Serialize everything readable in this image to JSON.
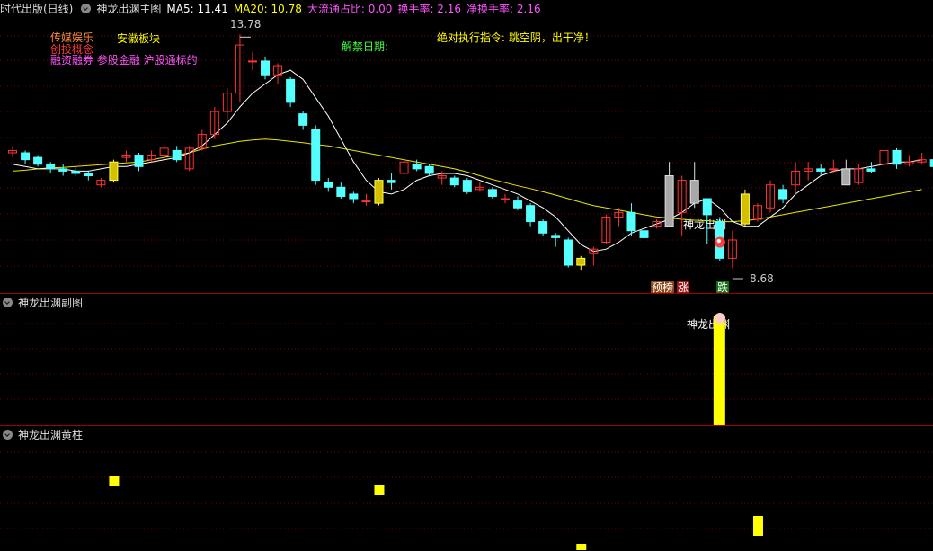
{
  "main_header": {
    "stock": "时代出版(日线)",
    "indicator": "神龙出渊主图",
    "ma5_label": "MA5: 11.41",
    "ma20_label": "MA20: 10.78",
    "flow_label": "大流通占比: 0.00",
    "turnover_label": "换手率: 2.16",
    "net_turnover_label": "净换手率: 2.16"
  },
  "annotations": {
    "sector1": "传媒娱乐",
    "sector2": "创投概念",
    "sector3": "融资融券 参股金融 沪股通标的",
    "region": "安徽板块",
    "unlock": "解禁日期:",
    "instruction": "绝对执行指令: 跳空阴，出干净！",
    "high_price": "13.78",
    "low_price": "8.68",
    "signal_text": "神龙出渊",
    "tag_predict": "预榜",
    "tag_up": "涨",
    "tag_down": "跌"
  },
  "sub1_header": {
    "title": "神龙出渊副图",
    "signal_text": "神龙出渊"
  },
  "sub2_header": {
    "title": "神龙出渊黄柱"
  },
  "colors": {
    "up": "#ff3232",
    "down": "#54ffff",
    "ma5": "#ffffff",
    "ma20": "#e6e600",
    "yellow": "#ffff00",
    "grid": "#7a0000",
    "separator": "#a00000",
    "ma5_text": "#ffffff",
    "ma20_text": "#ffff00",
    "flow_text": "#ff54ff"
  },
  "chart_data": {
    "type": "candlestick",
    "y_range": [
      8.3,
      14.1
    ],
    "high_marker": 13.78,
    "low_marker": 8.68,
    "candles": [
      {
        "o": 11.2,
        "c": 11.25,
        "h": 11.35,
        "l": 11.1
      },
      {
        "o": 11.2,
        "c": 11.05,
        "h": 11.25,
        "l": 10.95
      },
      {
        "o": 11.1,
        "c": 10.95,
        "h": 11.15,
        "l": 10.9
      },
      {
        "o": 10.95,
        "c": 10.85,
        "h": 11.0,
        "l": 10.75
      },
      {
        "o": 10.85,
        "c": 10.8,
        "h": 10.95,
        "l": 10.7
      },
      {
        "o": 10.8,
        "c": 10.75,
        "h": 10.9,
        "l": 10.7
      },
      {
        "o": 10.75,
        "c": 10.7,
        "h": 10.8,
        "l": 10.6
      },
      {
        "o": 10.5,
        "c": 10.6,
        "h": 10.65,
        "l": 10.45
      },
      {
        "o": 10.6,
        "c": 11.0,
        "h": 11.05,
        "l": 10.55,
        "gold": true
      },
      {
        "o": 11.1,
        "c": 11.15,
        "h": 11.25,
        "l": 11.0
      },
      {
        "o": 11.15,
        "c": 10.9,
        "h": 11.2,
        "l": 10.8
      },
      {
        "o": 11.05,
        "c": 11.15,
        "h": 11.25,
        "l": 11.0
      },
      {
        "o": 11.15,
        "c": 11.3,
        "h": 11.35,
        "l": 11.1
      },
      {
        "o": 11.25,
        "c": 11.05,
        "h": 11.35,
        "l": 11.0
      },
      {
        "o": 10.85,
        "c": 11.3,
        "h": 11.35,
        "l": 10.8
      },
      {
        "o": 11.3,
        "c": 11.6,
        "h": 11.7,
        "l": 11.25
      },
      {
        "o": 11.6,
        "c": 12.1,
        "h": 12.2,
        "l": 11.5
      },
      {
        "o": 12.1,
        "c": 12.5,
        "h": 12.6,
        "l": 11.9
      },
      {
        "o": 12.5,
        "c": 13.55,
        "h": 13.78,
        "l": 12.3
      },
      {
        "o": 13.2,
        "c": 13.2,
        "h": 13.4,
        "l": 13.0
      },
      {
        "o": 13.2,
        "c": 12.9,
        "h": 13.3,
        "l": 12.8
      },
      {
        "o": 12.9,
        "c": 13.1,
        "h": 13.15,
        "l": 12.7
      },
      {
        "o": 12.8,
        "c": 12.3,
        "h": 12.85,
        "l": 12.2
      },
      {
        "o": 12.05,
        "c": 11.8,
        "h": 12.1,
        "l": 11.7
      },
      {
        "o": 11.7,
        "c": 10.6,
        "h": 11.8,
        "l": 10.5
      },
      {
        "o": 10.55,
        "c": 10.45,
        "h": 10.65,
        "l": 10.35
      },
      {
        "o": 10.45,
        "c": 10.25,
        "h": 10.55,
        "l": 10.2
      },
      {
        "o": 10.3,
        "c": 10.2,
        "h": 10.35,
        "l": 10.1
      },
      {
        "o": 10.15,
        "c": 10.15,
        "h": 10.3,
        "l": 10.05
      },
      {
        "o": 10.1,
        "c": 10.6,
        "h": 10.65,
        "l": 10.05,
        "gold": true
      },
      {
        "o": 10.6,
        "c": 10.55,
        "h": 10.75,
        "l": 10.4
      },
      {
        "o": 10.75,
        "c": 11.0,
        "h": 11.1,
        "l": 10.6
      },
      {
        "o": 10.95,
        "c": 10.85,
        "h": 11.05,
        "l": 10.8
      },
      {
        "o": 10.9,
        "c": 10.75,
        "h": 10.95,
        "l": 10.7
      },
      {
        "o": 10.65,
        "c": 10.7,
        "h": 10.8,
        "l": 10.5
      },
      {
        "o": 10.65,
        "c": 10.5,
        "h": 10.7,
        "l": 10.45
      },
      {
        "o": 10.6,
        "c": 10.35,
        "h": 10.65,
        "l": 10.3
      },
      {
        "o": 10.4,
        "c": 10.45,
        "h": 10.55,
        "l": 10.35
      },
      {
        "o": 10.4,
        "c": 10.25,
        "h": 10.45,
        "l": 10.2
      },
      {
        "o": 10.2,
        "c": 10.2,
        "h": 10.3,
        "l": 10.1
      },
      {
        "o": 10.15,
        "c": 10.0,
        "h": 10.25,
        "l": 9.95
      },
      {
        "o": 10.05,
        "c": 9.7,
        "h": 10.1,
        "l": 9.6
      },
      {
        "o": 9.7,
        "c": 9.45,
        "h": 9.75,
        "l": 9.4
      },
      {
        "o": 9.4,
        "c": 9.35,
        "h": 9.45,
        "l": 9.15
      },
      {
        "o": 9.3,
        "c": 8.75,
        "h": 9.35,
        "l": 8.7
      },
      {
        "o": 8.75,
        "c": 8.9,
        "h": 8.95,
        "l": 8.65,
        "gold": true
      },
      {
        "o": 9.0,
        "c": 9.1,
        "h": 9.15,
        "l": 8.75
      },
      {
        "o": 9.25,
        "c": 9.8,
        "h": 9.85,
        "l": 9.2
      },
      {
        "o": 9.8,
        "c": 9.9,
        "h": 10.0,
        "l": 9.6
      },
      {
        "o": 9.9,
        "c": 9.5,
        "h": 10.1,
        "l": 9.4
      },
      {
        "o": 9.5,
        "c": 9.35,
        "h": 9.55,
        "l": 9.3
      },
      {
        "o": 9.6,
        "c": 9.7,
        "h": 9.75,
        "l": 9.55
      },
      {
        "o": 9.6,
        "c": 10.7,
        "h": 11.0,
        "l": 9.6,
        "gray": true
      },
      {
        "o": 9.9,
        "c": 10.6,
        "h": 10.7,
        "l": 9.4
      },
      {
        "o": 10.1,
        "c": 10.6,
        "h": 11.0,
        "l": 10.0,
        "gray": true
      },
      {
        "o": 10.2,
        "c": 9.85,
        "h": 10.2,
        "l": 9.2
      },
      {
        "o": 9.7,
        "c": 8.9,
        "h": 9.8,
        "l": 8.85
      },
      {
        "o": 8.9,
        "c": 9.3,
        "h": 9.5,
        "l": 8.68
      },
      {
        "o": 9.65,
        "c": 10.3,
        "h": 10.4,
        "l": 9.6,
        "gold": true
      },
      {
        "o": 9.75,
        "c": 10.05,
        "h": 10.1,
        "l": 9.7
      },
      {
        "o": 10.0,
        "c": 10.5,
        "h": 10.6,
        "l": 9.9
      },
      {
        "o": 10.4,
        "c": 10.2,
        "h": 10.5,
        "l": 10.1
      },
      {
        "o": 10.5,
        "c": 10.8,
        "h": 11.0,
        "l": 10.3
      },
      {
        "o": 10.8,
        "c": 10.85,
        "h": 11.0,
        "l": 10.6
      },
      {
        "o": 10.85,
        "c": 10.8,
        "h": 10.95,
        "l": 10.7
      },
      {
        "o": 10.85,
        "c": 10.85,
        "h": 11.05,
        "l": 10.75
      },
      {
        "o": 10.5,
        "c": 10.85,
        "h": 11.05,
        "l": 10.5,
        "gray": true
      },
      {
        "o": 10.55,
        "c": 10.85,
        "h": 10.95,
        "l": 10.5
      },
      {
        "o": 10.85,
        "c": 10.8,
        "h": 11.0,
        "l": 10.75
      },
      {
        "o": 10.95,
        "c": 11.25,
        "h": 11.3,
        "l": 10.9
      },
      {
        "o": 11.25,
        "c": 10.95,
        "h": 11.3,
        "l": 10.85
      },
      {
        "o": 10.95,
        "c": 11.0,
        "h": 11.15,
        "l": 10.9
      },
      {
        "o": 11.0,
        "c": 11.05,
        "h": 11.2,
        "l": 10.95
      },
      {
        "o": 11.05,
        "c": 10.9,
        "h": 11.1,
        "l": 10.8
      }
    ],
    "ma5": [
      10.95,
      10.9,
      10.85,
      10.85,
      10.85,
      10.8,
      10.8,
      10.85,
      10.9,
      10.9,
      10.95,
      11.0,
      11.05,
      11.1,
      11.2,
      11.35,
      11.6,
      11.85,
      12.2,
      12.5,
      12.7,
      12.9,
      13.0,
      12.8,
      12.4,
      12.0,
      11.5,
      11.0,
      10.6,
      10.35,
      10.3,
      10.4,
      10.6,
      10.7,
      10.75,
      10.75,
      10.7,
      10.6,
      10.5,
      10.4,
      10.3,
      10.15,
      10.0,
      9.8,
      9.5,
      9.2,
      9.05,
      9.1,
      9.25,
      9.45,
      9.55,
      9.65,
      9.75,
      9.9,
      10.1,
      10.2,
      10.0,
      9.7,
      9.6,
      9.6,
      9.8,
      10.0,
      10.3,
      10.5,
      10.7,
      10.8,
      10.85,
      10.85,
      10.9,
      10.95,
      11.0,
      11.0,
      11.05
    ],
    "ma20": [
      10.8,
      10.82,
      10.85,
      10.87,
      10.88,
      10.9,
      10.92,
      10.94,
      10.96,
      10.98,
      11.0,
      11.05,
      11.1,
      11.15,
      11.2,
      11.28,
      11.35,
      11.4,
      11.45,
      11.48,
      11.5,
      11.48,
      11.45,
      11.42,
      11.38,
      11.35,
      11.3,
      11.25,
      11.2,
      11.15,
      11.1,
      11.05,
      11.0,
      10.95,
      10.9,
      10.85,
      10.78,
      10.7,
      10.62,
      10.55,
      10.48,
      10.42,
      10.35,
      10.28,
      10.2,
      10.12,
      10.05,
      10.0,
      9.95,
      9.9,
      9.85,
      9.8,
      9.78,
      9.75,
      9.73,
      9.72,
      9.7,
      9.7,
      9.72,
      9.75,
      9.8,
      9.85,
      9.9,
      9.95,
      10.0,
      10.05,
      10.1,
      10.15,
      10.2,
      10.25,
      10.3,
      10.35,
      10.4
    ],
    "signal_index": 56,
    "signal_value_sub1": 1,
    "sub2_bars": [
      {
        "index": 8,
        "value": 0.55
      },
      {
        "index": 29,
        "value": 0.3
      },
      {
        "index": 45,
        "value": 0.05
      },
      {
        "index": 59,
        "value": 0.8
      }
    ]
  }
}
